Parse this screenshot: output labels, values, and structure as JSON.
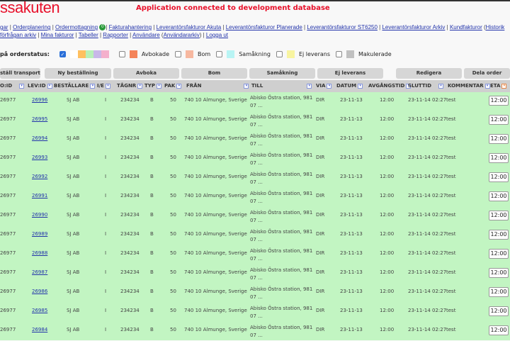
{
  "header": {
    "logo": "ssakuten",
    "env_message": "Application connected to development database"
  },
  "nav": {
    "line1": [
      "gar",
      "Orderplanering",
      "Ordermottagning",
      "Fakturahantering",
      "Leverantörsfakturor Akuta",
      "Leverantörsfakturor Planerade",
      "Leverantörsfakturor ST6250",
      "Leverantörsfakturor Arkiv",
      "Kundfakturor",
      "Historik"
    ],
    "badge": "0",
    "line2": [
      "förfrågan arkiv",
      "Mina fakturor",
      "Tabeller",
      "Rapporter",
      "Användare",
      "Användararkiv",
      "Logga ut"
    ]
  },
  "status_filter": {
    "label": "på orderstatus:",
    "items": [
      {
        "label": "Avbokade",
        "color": "#f4845a"
      },
      {
        "label": "Bom",
        "color": "#f7b8a0"
      },
      {
        "label": "Samåkning",
        "color": "#b8f4f4"
      },
      {
        "label": "Ej leverans",
        "color": "#f8f4a0"
      },
      {
        "label": "Makulerade",
        "color": "#c0c0c0"
      }
    ],
    "swatches": [
      "#ffffff",
      "#ffc060",
      "#b8f0b8",
      "#c8b8e8",
      "#f4b0cc"
    ]
  },
  "buttons": [
    "ställ transport",
    "Ny beställning",
    "Avboka",
    "Bom",
    "Samåkning",
    "Ej leverans",
    "Redigera",
    "Dela order"
  ],
  "columns": [
    "O:ID",
    "LEV:ID",
    "BESTÄLLARE",
    "I/E",
    "TÅGNR",
    "TYP",
    "PAK",
    "FRÅN",
    "TILL",
    "VIA",
    "DATUM",
    "AVGÅNGSTID",
    "SLUTTID",
    "KOMMENTAR",
    "ETA"
  ],
  "row_common": {
    "ord_id": "26977",
    "bestallare": "SJ AB",
    "ie": "I",
    "tagnr": "234234",
    "typ": "B",
    "pak": "50",
    "fran": "740 10 Almunge, Sverige",
    "till1": "Abisko Östra station, 981",
    "till2": "07 ...",
    "via": "DIR",
    "datum": "23-11-13",
    "avgang": "12:00",
    "sluttid": "23-11-14 02:27",
    "kommentar": "test",
    "eta": "12:00"
  },
  "rows": [
    "26996",
    "26995",
    "26994",
    "26993",
    "26992",
    "26991",
    "26990",
    "26989",
    "26988",
    "26987",
    "26986",
    "26985",
    "26984"
  ]
}
